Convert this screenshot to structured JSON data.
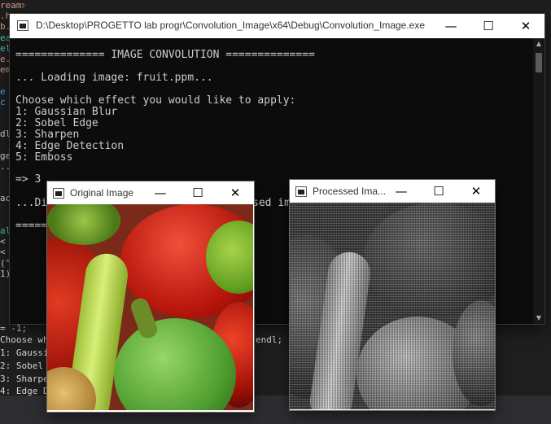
{
  "ide": {
    "left_lines": [
      "ream>",
      ".h",
      "b.h",
      "ea",
      "el",
      "e.",
      "em",
      "",
      "e",
      "c",
      "",
      "",
      "dl",
      "",
      "ge",
      "..",
      "",
      "",
      "ac",
      "",
      "",
      "al",
      "<",
      "<",
      "(\"",
      "1)",
      "",
      ""
    ],
    "bottom_lines": [
      "= -1;",
      "Choose wh",
      "1: Gaussi",
      "2: Sobel",
      "3: Sharpe",
      "4: Edge D"
    ],
    "bottom_right_fragment": "endl;"
  },
  "console_window": {
    "title": "D:\\Desktop\\PROGETTO lab progr\\Convolution_Image\\x64\\Debug\\Convolution_Image.exe",
    "minimize": "—",
    "maximize": "☐",
    "close": "✕",
    "lines": [
      "============== IMAGE CONVOLUTION ==============",
      "",
      "... Loading image: fruit.ppm...",
      "",
      "Choose which effect you would like to apply:",
      "1: Gaussian Blur",
      "2: Sobel Edge",
      "3: Sharpen",
      "4: Edge Detection",
      "5: Emboss",
      "",
      "=> 3",
      "",
      "...Di",
      "",
      "======"
    ],
    "partial_line": "sed im"
  },
  "original_window": {
    "title": "Original Image",
    "minimize": "—",
    "maximize": "☐",
    "close": "✕"
  },
  "processed_window": {
    "title": "Processed Ima...",
    "minimize": "—",
    "maximize": "☐",
    "close": "✕"
  }
}
